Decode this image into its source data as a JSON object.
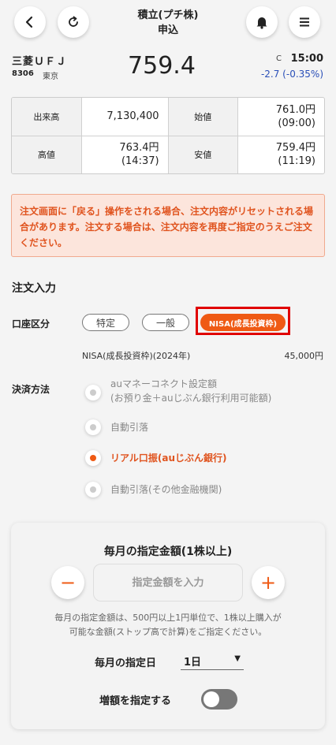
{
  "header": {
    "title_line1": "積立(プチ株)",
    "title_line2": "申込",
    "icons": {
      "back": "chevron-left-icon",
      "refresh": "refresh-icon",
      "bell": "bell-icon",
      "menu": "hamburger-menu-icon"
    }
  },
  "stock": {
    "name": "三菱ＵＦＪ",
    "code": "8306",
    "market": "東京",
    "price": "759.4",
    "flag": "C",
    "time": "15:00",
    "change": "-2.7 (-0.35%)",
    "change_color": "#2a4fb8"
  },
  "quote_table": {
    "rows": [
      {
        "label1": "出来高",
        "value1": "7,130,400",
        "label2": "始値",
        "value2": "761.0円",
        "value2_sub": "(09:00)"
      },
      {
        "label1": "高値",
        "value1": "763.4円",
        "value1_sub": "(14:37)",
        "label2": "安値",
        "value2": "759.4円",
        "value2_sub": "(11:19)"
      }
    ]
  },
  "warning": {
    "text": "注文画面に「戻る」操作をされる場合、注文内容がリセットされる場合があります。注文する場合は、注文内容を再度ご指定のうえご注文ください。"
  },
  "order": {
    "section_title": "注文入力",
    "account_label": "口座区分",
    "account_options": [
      "特定",
      "一般",
      "NISA(成長投資枠)"
    ],
    "account_selected": "NISA(成長投資枠)",
    "nisa_line": "NISA(成長投資枠)(2024年)",
    "nisa_amount": "45,000円",
    "payment_label": "決済方法",
    "payment_options": [
      {
        "line1": "auマネーコネクト設定額",
        "line2": "(お預り金＋auじぶん銀行利用可能額)"
      },
      {
        "line1": "自動引落"
      },
      {
        "line1": "リアル口振(auじぶん銀行)"
      },
      {
        "line1": "自動引落(その他金融機関)"
      }
    ],
    "payment_selected": "リアル口振(auじぶん銀行)"
  },
  "monthly": {
    "title": "毎月の指定金額(1株以上)",
    "minus": "−",
    "plus": "+",
    "amount_placeholder": "指定金額を入力",
    "note_line1": "毎月の指定金額は、500円以上1円単位で、1株以上購入が",
    "note_line2": "可能な金額(ストップ高で計算)をご指定ください。",
    "day_label": "毎月の指定日",
    "day_value": "1日",
    "day_caret": "▼",
    "increase_label": "増額を指定する",
    "increase_enabled": false
  },
  "colors": {
    "accent": "#ef5a14",
    "warning_bg": "#fce5dc",
    "warning_text": "#e0541f",
    "highlight_frame": "#e00000"
  }
}
